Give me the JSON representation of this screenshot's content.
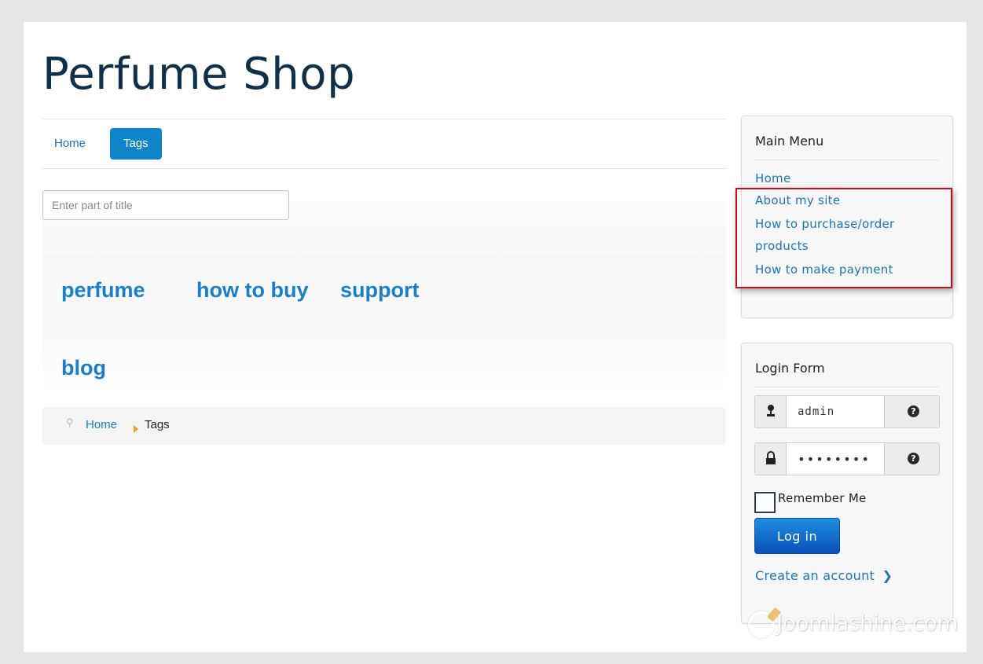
{
  "site": {
    "title": "Perfume Shop"
  },
  "nav": {
    "home": "Home",
    "tags": "Tags"
  },
  "search": {
    "placeholder": "Enter part of title"
  },
  "tags": [
    "perfume",
    "how to buy",
    "support",
    "blog"
  ],
  "breadcrumb": {
    "home": "Home",
    "current": "Tags"
  },
  "main_menu": {
    "title": "Main Menu",
    "items": [
      "Home",
      "About my site",
      "How to purchase/order",
      "products",
      "How to make payment"
    ]
  },
  "login": {
    "title": "Login Form",
    "username": "admin",
    "password": "••••••••",
    "help_glyph": "?",
    "remember_label": "Remember Me",
    "login_button": "Log in",
    "create_account": "Create an account",
    "create_account_chevron": "❯"
  },
  "watermark": "Joomlashine.com",
  "colors": {
    "accent": "#0e84c9",
    "link": "#1a75bb",
    "highlight": "#c0101a"
  }
}
